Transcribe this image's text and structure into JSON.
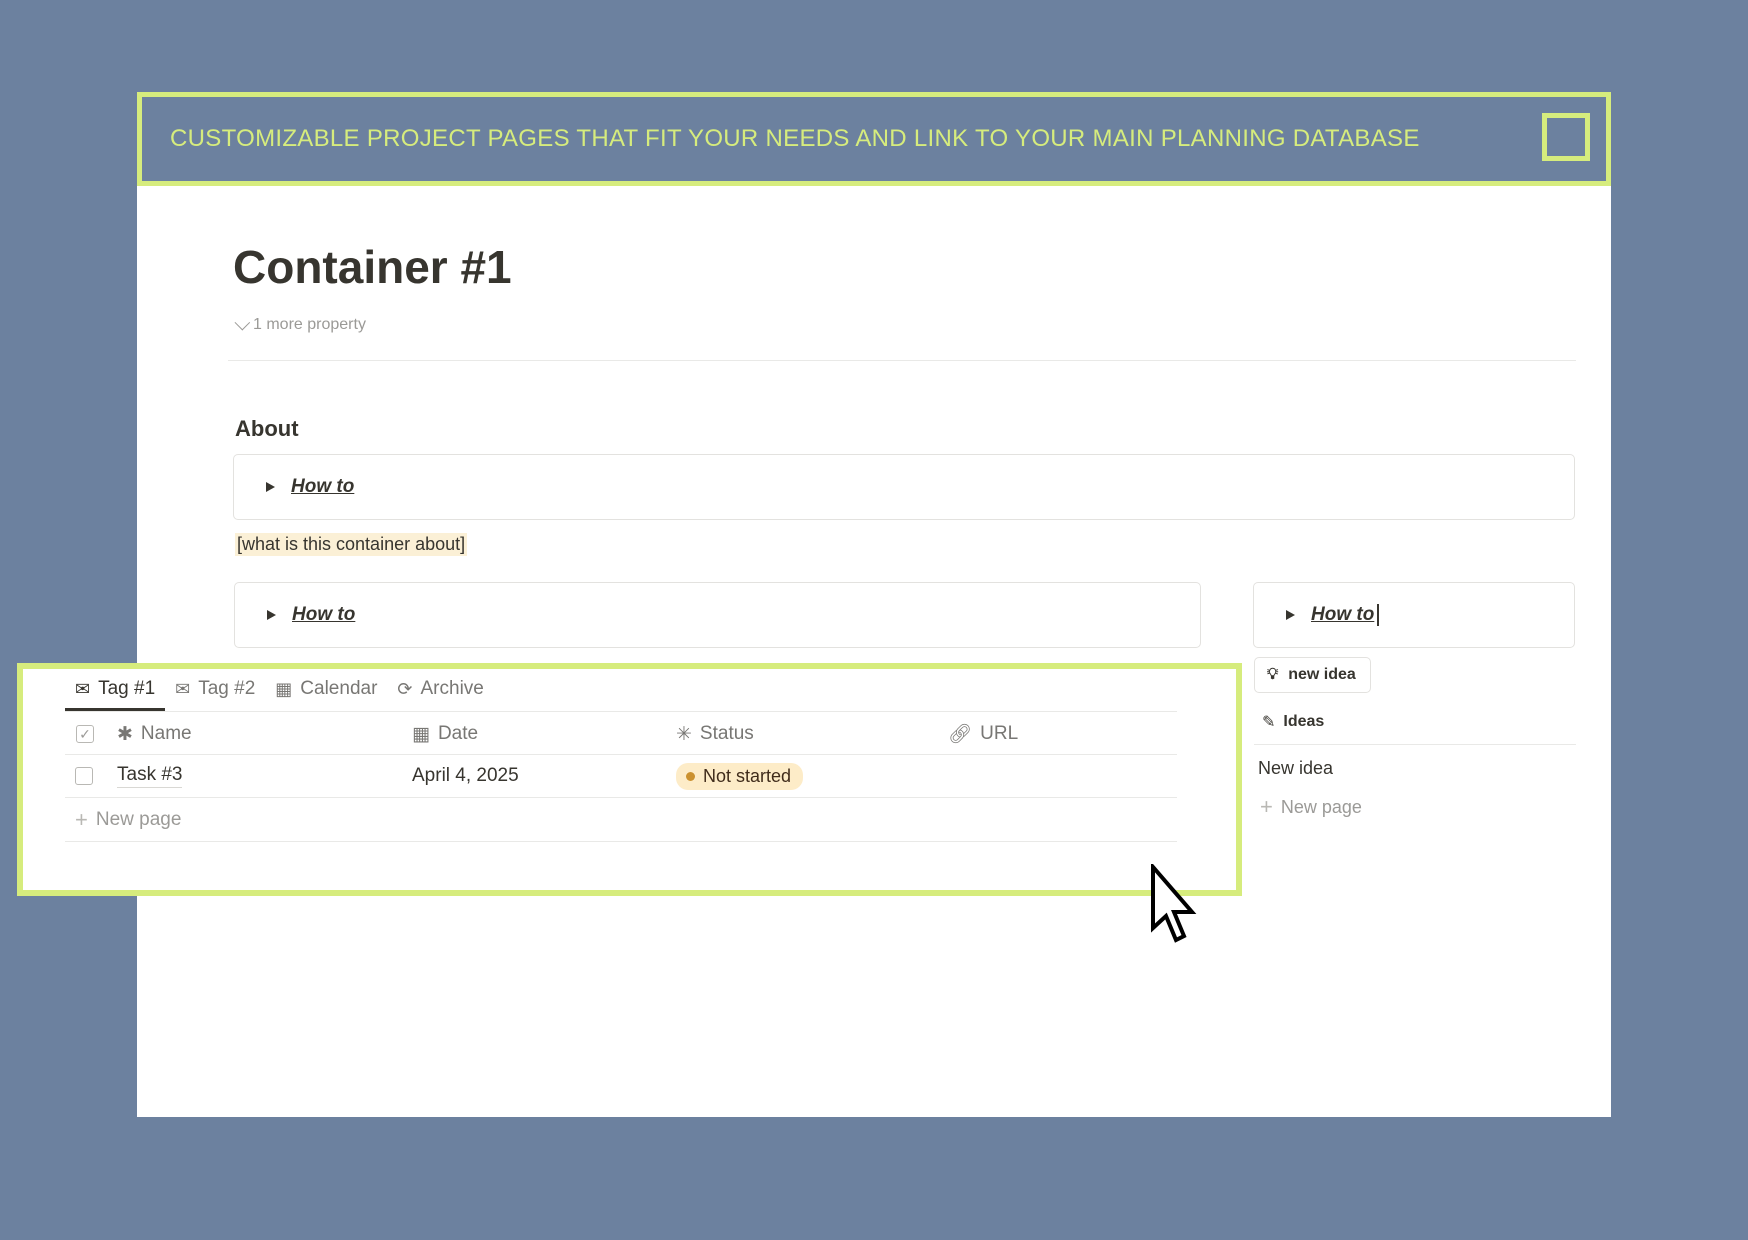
{
  "banner": {
    "text": "CUSTOMIZABLE PROJECT PAGES THAT FIT YOUR NEEDS AND LINK TO YOUR MAIN PLANNING DATABASE"
  },
  "page": {
    "title": "Container #1",
    "more_property": "1 more property",
    "about_heading": "About",
    "toggles": [
      "How to",
      "How to",
      "How to"
    ],
    "about_placeholder": "[what is this container about]"
  },
  "database": {
    "tabs": [
      {
        "label": "Tag #1",
        "icon": "envelope-icon",
        "active": true
      },
      {
        "label": "Tag #2",
        "icon": "envelope-icon",
        "active": false
      },
      {
        "label": "Calendar",
        "icon": "calendar-icon",
        "active": false
      },
      {
        "label": "Archive",
        "icon": "archive-icon",
        "active": false
      }
    ],
    "columns": [
      "Name",
      "Date",
      "Status",
      "URL"
    ],
    "rows": [
      {
        "name": "Task #3",
        "date": "April 4, 2025",
        "status": "Not started",
        "url": ""
      }
    ],
    "new_page": "New page"
  },
  "ideas": {
    "button_label": "new idea",
    "header": "Ideas",
    "items": [
      "New idea"
    ],
    "new_page": "New page"
  },
  "colors": {
    "background": "#6c819f",
    "accent": "#d6ec7d",
    "status_not_started_bg": "#fdecc8",
    "status_not_started_dot": "#cb912f"
  }
}
